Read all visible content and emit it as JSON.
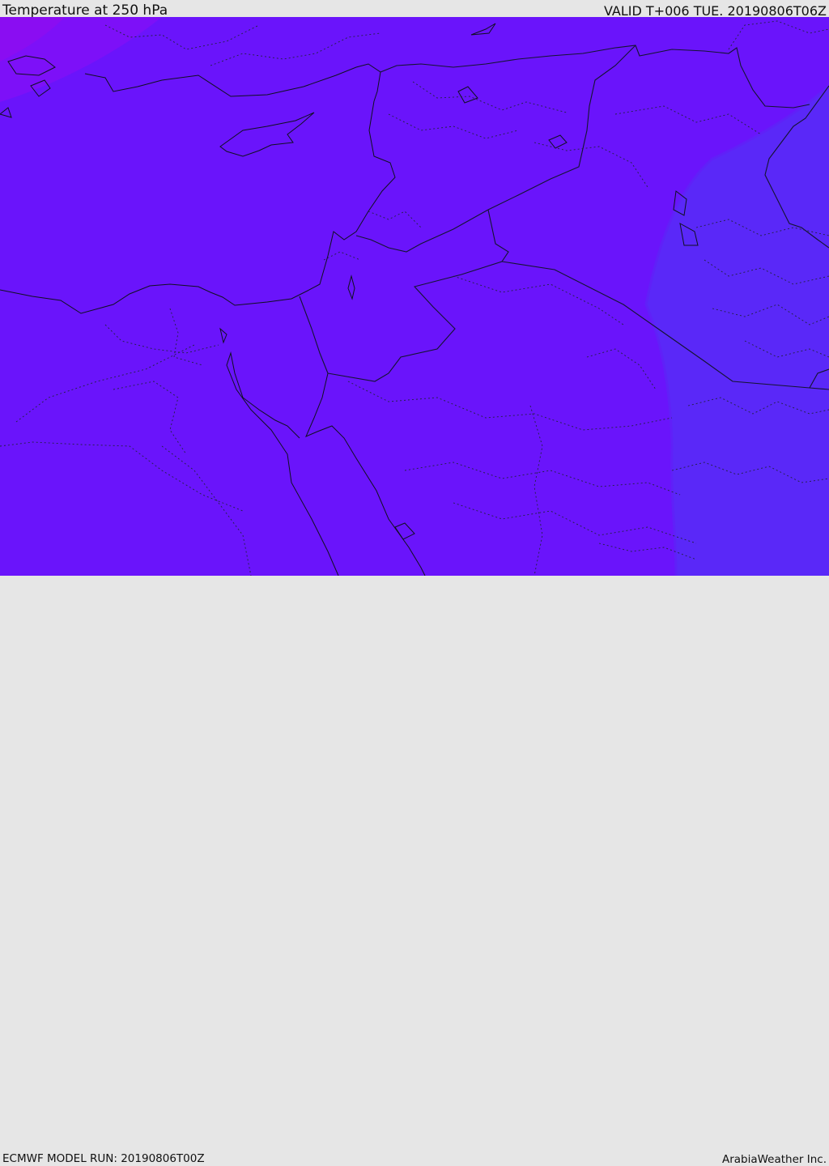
{
  "header": {
    "title": "Temperature at 250 hPa",
    "valid_time": "VALID T+006 TUE. 20190806T06Z"
  },
  "footer": {
    "model_run": "ECMWF MODEL RUN: 20190806T00Z",
    "credit": "ArabiaWeather Inc."
  },
  "colors": {
    "base_field": "#6a14fb",
    "northwest_field": "#7d10f8",
    "northwest_core": "#8a0df2",
    "east_field": "#5a28f8",
    "coastline": "#101020",
    "border": "#141430"
  }
}
